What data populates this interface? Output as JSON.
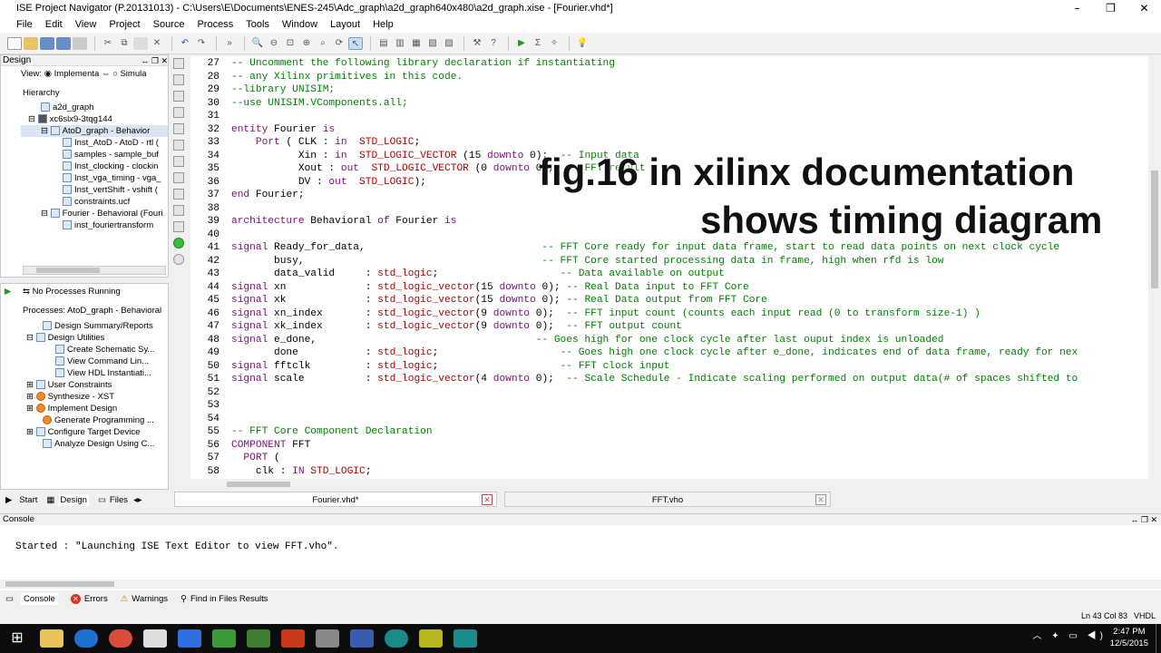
{
  "window": {
    "title": "ISE Project Navigator (P.20131013) - C:\\Users\\E\\Documents\\ENES-245\\Adc_graph\\a2d_graph640x480\\a2d_graph.xise - [Fourier.vhd*]",
    "minimize": "–",
    "maximize": "❐",
    "close": "✕"
  },
  "menu": [
    "File",
    "Edit",
    "View",
    "Project",
    "Source",
    "Process",
    "Tools",
    "Window",
    "Layout",
    "Help"
  ],
  "design_panel": {
    "title": "Design",
    "view_label": "View:",
    "view_impl": "Implementa",
    "view_sim": "Simula",
    "hierarchy_label": "Hierarchy",
    "tree": [
      "a2d_graph",
      "xc6slx9-3tqg144",
      "AtoD_graph - Behavior",
      "Inst_AtoD - AtoD - rtl (",
      "samples - sample_buf",
      "Inst_clocking - clockin",
      "Inst_vga_timing - vga_",
      "Inst_vertShift - vshift (",
      "constraints.ucf",
      "Fourier - Behavioral (Fouri",
      "inst_fouriertransform"
    ]
  },
  "processes_panel": {
    "no_running": "No Processes Running",
    "title": "Processes: AtoD_graph - Behavioral",
    "items": [
      "Design Summary/Reports",
      "Design Utilities",
      "Create Schematic Sy...",
      "View Command Lin...",
      "View HDL Instantiati...",
      "User Constraints",
      "Synthesize - XST",
      "Implement Design",
      "Generate Programming ...",
      "Configure Target Device",
      "Analyze Design Using C..."
    ]
  },
  "left_tabs": [
    "Start",
    "Design",
    "Files"
  ],
  "code": {
    "lines": [
      {
        "n": "27",
        "segs": [
          [
            "cm",
            "-- Uncomment the following library declaration if instantiating"
          ]
        ]
      },
      {
        "n": "28",
        "segs": [
          [
            "cm",
            "-- any Xilinx primitives in this code."
          ]
        ]
      },
      {
        "n": "29",
        "segs": [
          [
            "cm",
            "--library UNISIM;"
          ]
        ]
      },
      {
        "n": "30",
        "segs": [
          [
            "cm",
            "--use UNISIM.VComponents.all;"
          ]
        ]
      },
      {
        "n": "31",
        "segs": []
      },
      {
        "n": "32",
        "segs": [
          [
            "kw",
            "entity"
          ],
          [
            "nm",
            " Fourier "
          ],
          [
            "kw",
            "is"
          ]
        ]
      },
      {
        "n": "33",
        "segs": [
          [
            "kw",
            "    Port"
          ],
          [
            "nm",
            " ( CLK : "
          ],
          [
            "kw",
            "in"
          ],
          [
            "nm",
            "  "
          ],
          [
            "ty",
            "STD_LOGIC"
          ],
          [
            "nm",
            ";"
          ]
        ]
      },
      {
        "n": "34",
        "segs": [
          [
            "nm",
            "           Xin : "
          ],
          [
            "kw",
            "in"
          ],
          [
            "nm",
            "  "
          ],
          [
            "ty",
            "STD_LOGIC_VECTOR"
          ],
          [
            "nm",
            " (15 "
          ],
          [
            "kw",
            "downto"
          ],
          [
            "nm",
            " 0);  "
          ],
          [
            "cm",
            "-- Input data"
          ]
        ]
      },
      {
        "n": "35",
        "segs": [
          [
            "nm",
            "           Xout : "
          ],
          [
            "kw",
            "out"
          ],
          [
            "nm",
            "  "
          ],
          [
            "ty",
            "STD_LOGIC_VECTOR"
          ],
          [
            "nm",
            " (0 "
          ],
          [
            "kw",
            "downto"
          ],
          [
            "nm",
            " 0);  "
          ],
          [
            "cm",
            "-- FFT result"
          ]
        ]
      },
      {
        "n": "36",
        "segs": [
          [
            "nm",
            "           DV : "
          ],
          [
            "kw",
            "out"
          ],
          [
            "nm",
            "  "
          ],
          [
            "ty",
            "STD_LOGIC"
          ],
          [
            "nm",
            ");"
          ]
        ]
      },
      {
        "n": "37",
        "segs": [
          [
            "kw",
            "end"
          ],
          [
            "nm",
            " Fourier;"
          ]
        ]
      },
      {
        "n": "38",
        "segs": []
      },
      {
        "n": "39",
        "segs": [
          [
            "kw",
            "architecture"
          ],
          [
            "nm",
            " Behavioral "
          ],
          [
            "kw",
            "of"
          ],
          [
            "nm",
            " Fourier "
          ],
          [
            "kw",
            "is"
          ]
        ]
      },
      {
        "n": "40",
        "segs": []
      },
      {
        "n": "41",
        "segs": [
          [
            "kw",
            "signal"
          ],
          [
            "nm",
            " Ready_for_data,                             "
          ],
          [
            "cm",
            "-- FFT Core ready for input data frame, start to read data points on next clock cycle"
          ]
        ]
      },
      {
        "n": "42",
        "segs": [
          [
            "nm",
            "       busy,                                       "
          ],
          [
            "cm",
            "-- FFT Core started processing data in frame, high when rfd is low"
          ]
        ]
      },
      {
        "n": "43",
        "segs": [
          [
            "nm",
            "       data_valid     : "
          ],
          [
            "ty",
            "std_logic"
          ],
          [
            "nm",
            ";                    "
          ],
          [
            "cm",
            "-- Data available on output"
          ]
        ]
      },
      {
        "n": "44",
        "segs": [
          [
            "kw",
            "signal"
          ],
          [
            "nm",
            " xn             : "
          ],
          [
            "ty",
            "std_logic_vector"
          ],
          [
            "nm",
            "(15 "
          ],
          [
            "kw",
            "downto"
          ],
          [
            "nm",
            " 0); "
          ],
          [
            "cm",
            "-- Real Data input to FFT Core"
          ]
        ]
      },
      {
        "n": "45",
        "segs": [
          [
            "kw",
            "signal"
          ],
          [
            "nm",
            " xk             : "
          ],
          [
            "ty",
            "std_logic_vector"
          ],
          [
            "nm",
            "(15 "
          ],
          [
            "kw",
            "downto"
          ],
          [
            "nm",
            " 0); "
          ],
          [
            "cm",
            "-- Real Data output from FFT Core"
          ]
        ]
      },
      {
        "n": "46",
        "segs": [
          [
            "kw",
            "signal"
          ],
          [
            "nm",
            " xn_index       : "
          ],
          [
            "ty",
            "std_logic_vector"
          ],
          [
            "nm",
            "(9 "
          ],
          [
            "kw",
            "downto"
          ],
          [
            "nm",
            " 0);  "
          ],
          [
            "cm",
            "-- FFT input count (counts each input read (0 to transform size-1) )"
          ]
        ]
      },
      {
        "n": "47",
        "segs": [
          [
            "kw",
            "signal"
          ],
          [
            "nm",
            " xk_index       : "
          ],
          [
            "ty",
            "std_logic_vector"
          ],
          [
            "nm",
            "(9 "
          ],
          [
            "kw",
            "downto"
          ],
          [
            "nm",
            " 0);  "
          ],
          [
            "cm",
            "-- FFT output count"
          ]
        ]
      },
      {
        "n": "48",
        "segs": [
          [
            "kw",
            "signal"
          ],
          [
            "nm",
            " e_done,                                    "
          ],
          [
            "cm",
            "-- Goes high for one clock cycle after last ouput index is unloaded"
          ]
        ]
      },
      {
        "n": "49",
        "segs": [
          [
            "nm",
            "       done           : "
          ],
          [
            "ty",
            "std_logic"
          ],
          [
            "nm",
            ";                    "
          ],
          [
            "cm",
            "-- Goes high one clock cycle after e_done, indicates end of data frame, ready for nex"
          ]
        ]
      },
      {
        "n": "50",
        "segs": [
          [
            "kw",
            "signal"
          ],
          [
            "nm",
            " fftclk         : "
          ],
          [
            "ty",
            "std_logic"
          ],
          [
            "nm",
            ";                    "
          ],
          [
            "cm",
            "-- FFT clock input"
          ]
        ]
      },
      {
        "n": "51",
        "segs": [
          [
            "kw",
            "signal"
          ],
          [
            "nm",
            " scale          : "
          ],
          [
            "ty",
            "std_logic_vector"
          ],
          [
            "nm",
            "(4 "
          ],
          [
            "kw",
            "downto"
          ],
          [
            "nm",
            " 0);  "
          ],
          [
            "cm",
            "-- Scale Schedule - Indicate scaling performed on output data(# of spaces shifted to"
          ]
        ]
      },
      {
        "n": "52",
        "segs": []
      },
      {
        "n": "53",
        "segs": []
      },
      {
        "n": "54",
        "segs": []
      },
      {
        "n": "55",
        "segs": [
          [
            "cm",
            "-- FFT Core Component Declaration"
          ]
        ]
      },
      {
        "n": "56",
        "segs": [
          [
            "kw",
            "COMPONENT"
          ],
          [
            "nm",
            " FFT"
          ]
        ]
      },
      {
        "n": "57",
        "segs": [
          [
            "kw",
            "  PORT"
          ],
          [
            "nm",
            " ("
          ]
        ]
      },
      {
        "n": "58",
        "segs": [
          [
            "nm",
            "    clk : "
          ],
          [
            "kw",
            "IN"
          ],
          [
            "nm",
            " "
          ],
          [
            "ty",
            "STD_LOGIC"
          ],
          [
            "nm",
            ";"
          ]
        ]
      }
    ]
  },
  "overlay": {
    "line1": "fig.16 in xilinx documentation",
    "line2": "shows timing diagram"
  },
  "editor_tabs": [
    {
      "label": "Fourier.vhd*"
    },
    {
      "label": "FFT.vho"
    }
  ],
  "console": {
    "title": "Console",
    "text": "Started : \"Launching ISE Text Editor to view FFT.vho\".",
    "tabs": [
      "Console",
      "Errors",
      "Warnings",
      "Find in Files Results"
    ]
  },
  "status": {
    "position": "Ln 43 Col 83",
    "lang": "VHDL"
  },
  "taskbar": {
    "time": "2:47 PM",
    "date": "12/5/2015"
  }
}
